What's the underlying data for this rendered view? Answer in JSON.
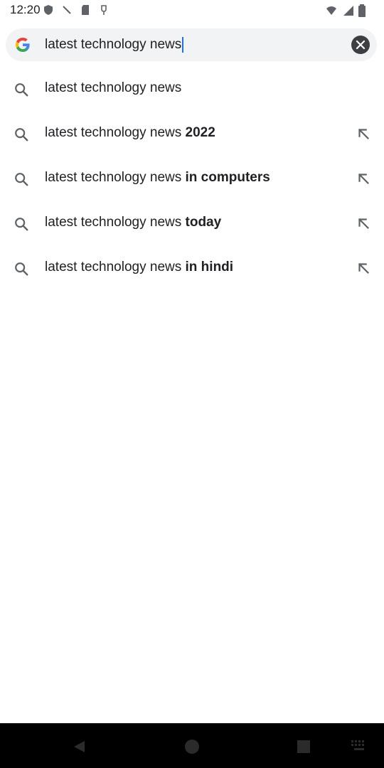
{
  "status_bar": {
    "time": "12:20"
  },
  "search": {
    "query": "latest technology news"
  },
  "suggestions": [
    {
      "prefix": "latest technology news",
      "bold": ""
    },
    {
      "prefix": "latest technology news ",
      "bold": "2022"
    },
    {
      "prefix": "latest technology news ",
      "bold": "in computers"
    },
    {
      "prefix": "latest technology news ",
      "bold": "today"
    },
    {
      "prefix": "latest technology news ",
      "bold": "in hindi"
    }
  ],
  "icons": {
    "google": "google-logo-icon",
    "clear": "close-icon",
    "suggestion": "search-icon",
    "fill": "arrow-up-left-icon"
  },
  "colors": {
    "search_bg": "#f1f3f4",
    "text": "#202124",
    "icon_gray": "#5f6368",
    "nav_bg": "#000000"
  }
}
